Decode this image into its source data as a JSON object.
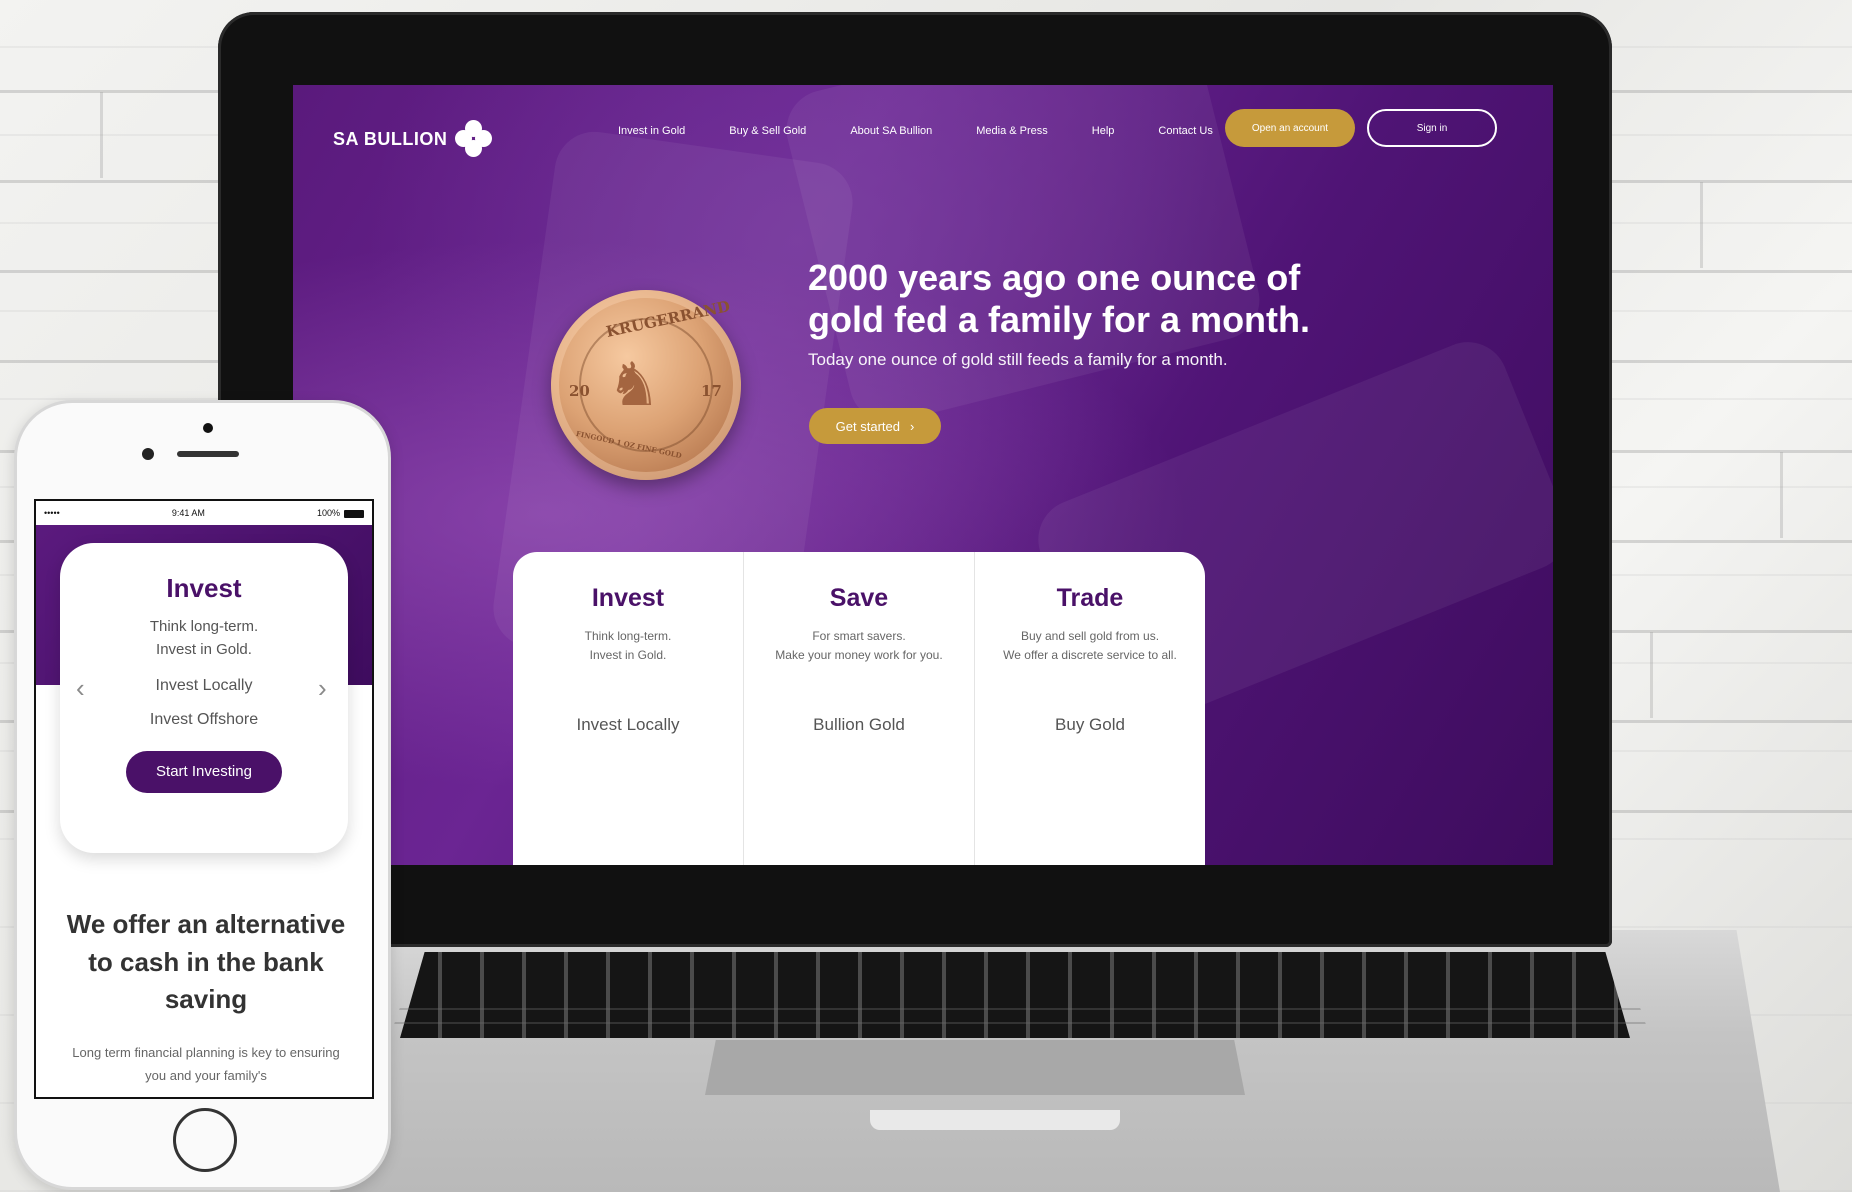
{
  "desktop": {
    "brand": "SA BULLION",
    "nav": [
      "Invest in Gold",
      "Buy & Sell Gold",
      "About SA Bullion",
      "Media & Press",
      "Help",
      "Contact Us"
    ],
    "open_account": "Open an account",
    "sign_in": "Sign in",
    "coin": {
      "top_text": "KRUGERRAND",
      "year_left": "20",
      "year_right": "17",
      "bottom_text": "FINGOUD 1 OZ FINE GOLD"
    },
    "hero_title": "2000 years ago one ounce of gold fed a family for a month.",
    "hero_subtitle": "Today one ounce of gold still feeds a family for a month.",
    "get_started": "Get started",
    "cards": [
      {
        "title": "Invest",
        "line1": "Think long-term.",
        "line2": "Invest in Gold.",
        "link": "Invest Locally"
      },
      {
        "title": "Save",
        "line1": "For smart savers.",
        "line2": "Make your money work for you.",
        "link": "Bullion Gold"
      },
      {
        "title": "Trade",
        "line1": "Buy and sell gold from us.",
        "line2": "We offer a discrete service to all.",
        "link": "Buy Gold"
      }
    ]
  },
  "mobile": {
    "status": {
      "signal": "•••••",
      "time": "9:41 AM",
      "battery": "100%"
    },
    "card": {
      "title": "Invest",
      "line1": "Think long-term.",
      "line2": "Invest in Gold.",
      "option1": "Invest Locally",
      "option2": "Invest Offshore",
      "cta": "Start Investing"
    },
    "heading": "We offer an alternative to cash in the bank saving",
    "body": "Long term financial planning is key to ensuring you and your family's"
  },
  "colors": {
    "purple": "#4a1168",
    "gold": "#c69a3b"
  }
}
